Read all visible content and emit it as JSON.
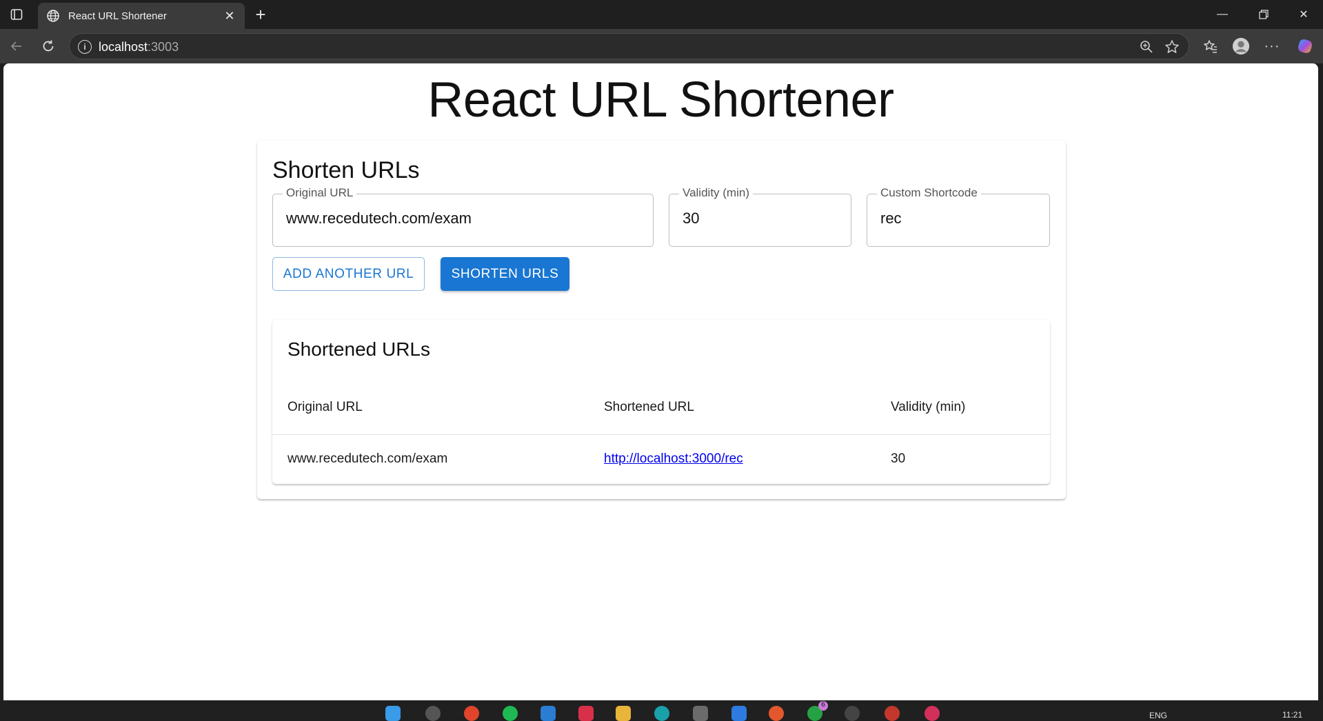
{
  "browser": {
    "tab_title": "React URL Shortener",
    "address_host": "localhost",
    "address_port": ":3003"
  },
  "page": {
    "title": "React URL Shortener"
  },
  "form": {
    "section_title": "Shorten URLs",
    "original_url_label": "Original URL",
    "original_url_value": "www.recedutech.com/exam",
    "validity_label": "Validity (min)",
    "validity_value": "30",
    "shortcode_label": "Custom Shortcode",
    "shortcode_value": "rec",
    "add_button": "ADD ANOTHER URL",
    "shorten_button": "SHORTEN URLS"
  },
  "results": {
    "title": "Shortened URLs",
    "columns": [
      "Original URL",
      "Shortened URL",
      "Validity (min)"
    ],
    "rows": [
      {
        "original": "www.recedutech.com/exam",
        "short": "http://localhost:3000/rec",
        "validity": "30"
      }
    ]
  },
  "taskbar": {
    "lang": "ENG",
    "time": "11:21",
    "badge": "6"
  }
}
